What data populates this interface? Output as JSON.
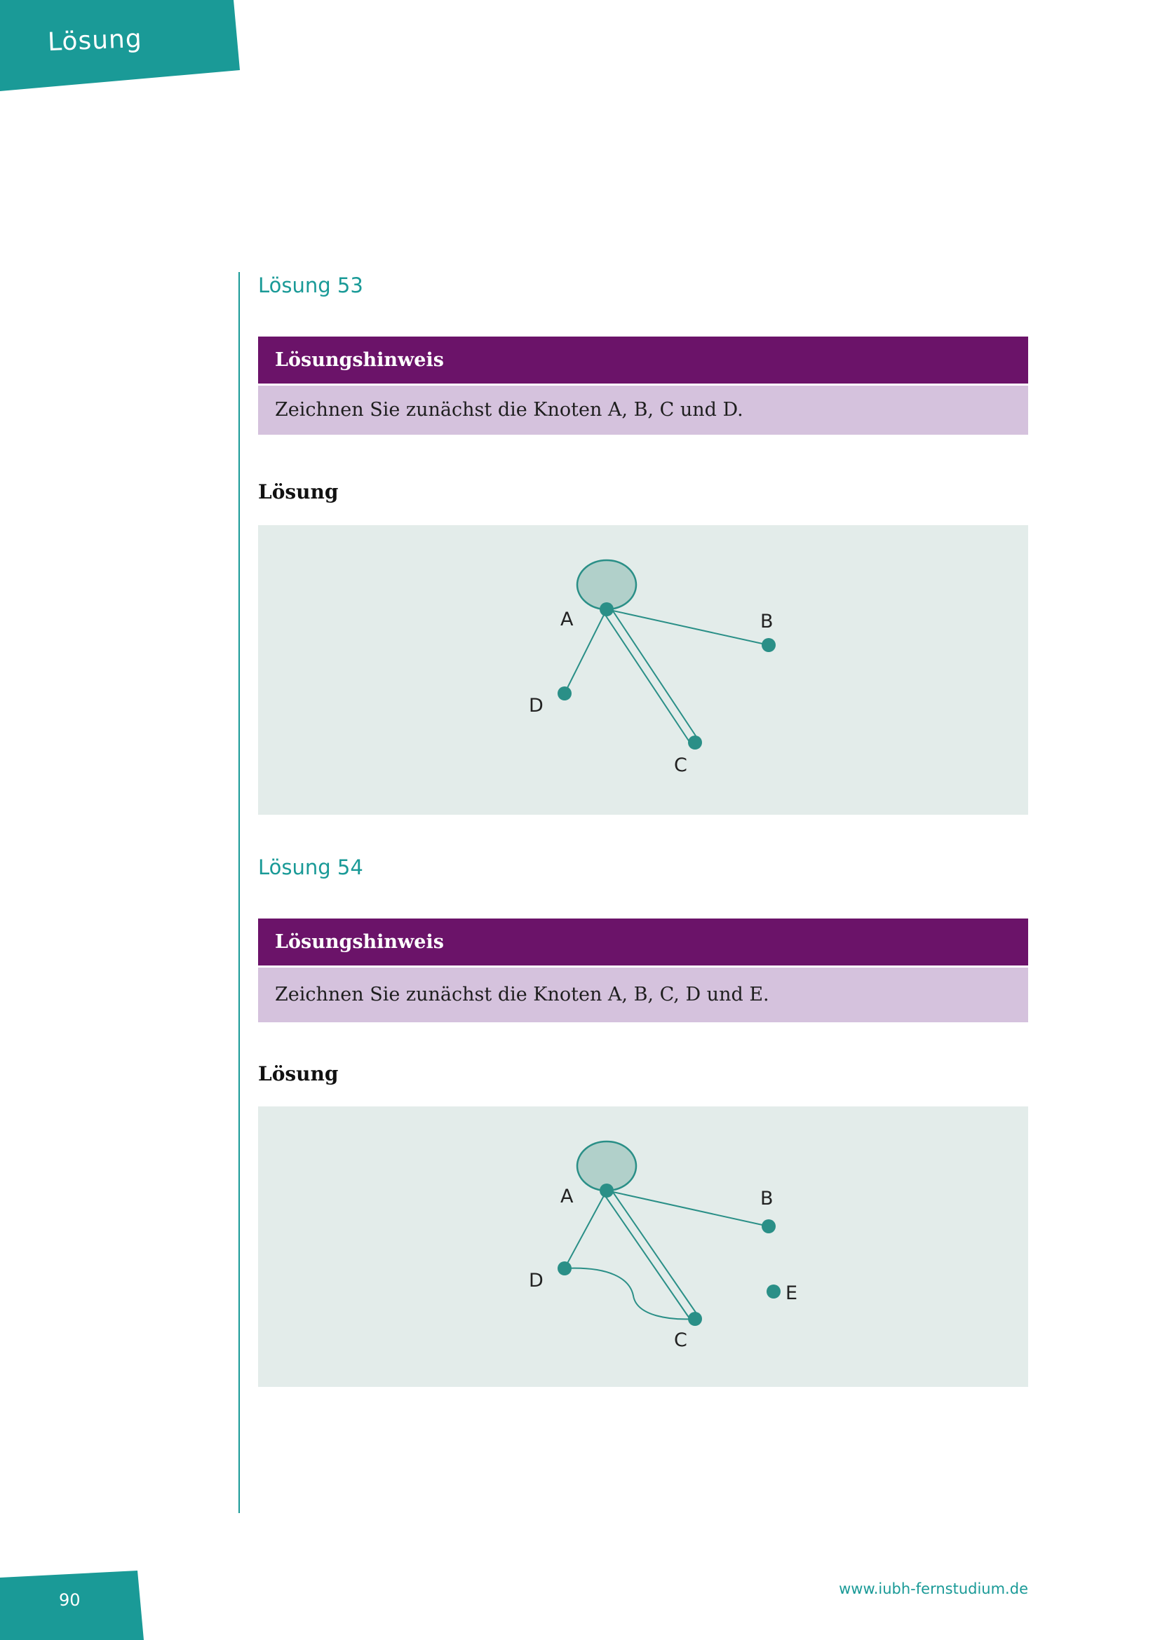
{
  "header": {
    "tab_label": "Lösung"
  },
  "solutions": [
    {
      "title": "Lösung 53",
      "hint_heading": "Lösungshinweis",
      "hint_text": "Zeichnen Sie zunächst die Knoten A, B, C und D.",
      "solution_label": "Lösung",
      "graph": {
        "nodes": [
          "A",
          "B",
          "C",
          "D"
        ],
        "edges": [
          [
            "A",
            "A",
            "loop"
          ],
          [
            "A",
            "B",
            "single"
          ],
          [
            "A",
            "C",
            "double"
          ],
          [
            "A",
            "D",
            "single"
          ]
        ]
      }
    },
    {
      "title": "Lösung 54",
      "hint_heading": "Lösungshinweis",
      "hint_text": "Zeichnen Sie zunächst die Knoten A, B, C, D und E.",
      "solution_label": "Lösung",
      "graph": {
        "nodes": [
          "A",
          "B",
          "C",
          "D",
          "E"
        ],
        "edges": [
          [
            "A",
            "A",
            "loop"
          ],
          [
            "A",
            "B",
            "single"
          ],
          [
            "A",
            "C",
            "double"
          ],
          [
            "A",
            "D",
            "single"
          ],
          [
            "D",
            "C",
            "curve"
          ]
        ]
      }
    }
  ],
  "footer": {
    "page_number": "90",
    "url": "www.iubh-fernstudium.de"
  },
  "colors": {
    "teal": "#1a9a97",
    "purple": "#6b1369",
    "lilac": "#d5c2dd",
    "figure_bg": "#e3ecea",
    "node": "#2a8f87"
  }
}
